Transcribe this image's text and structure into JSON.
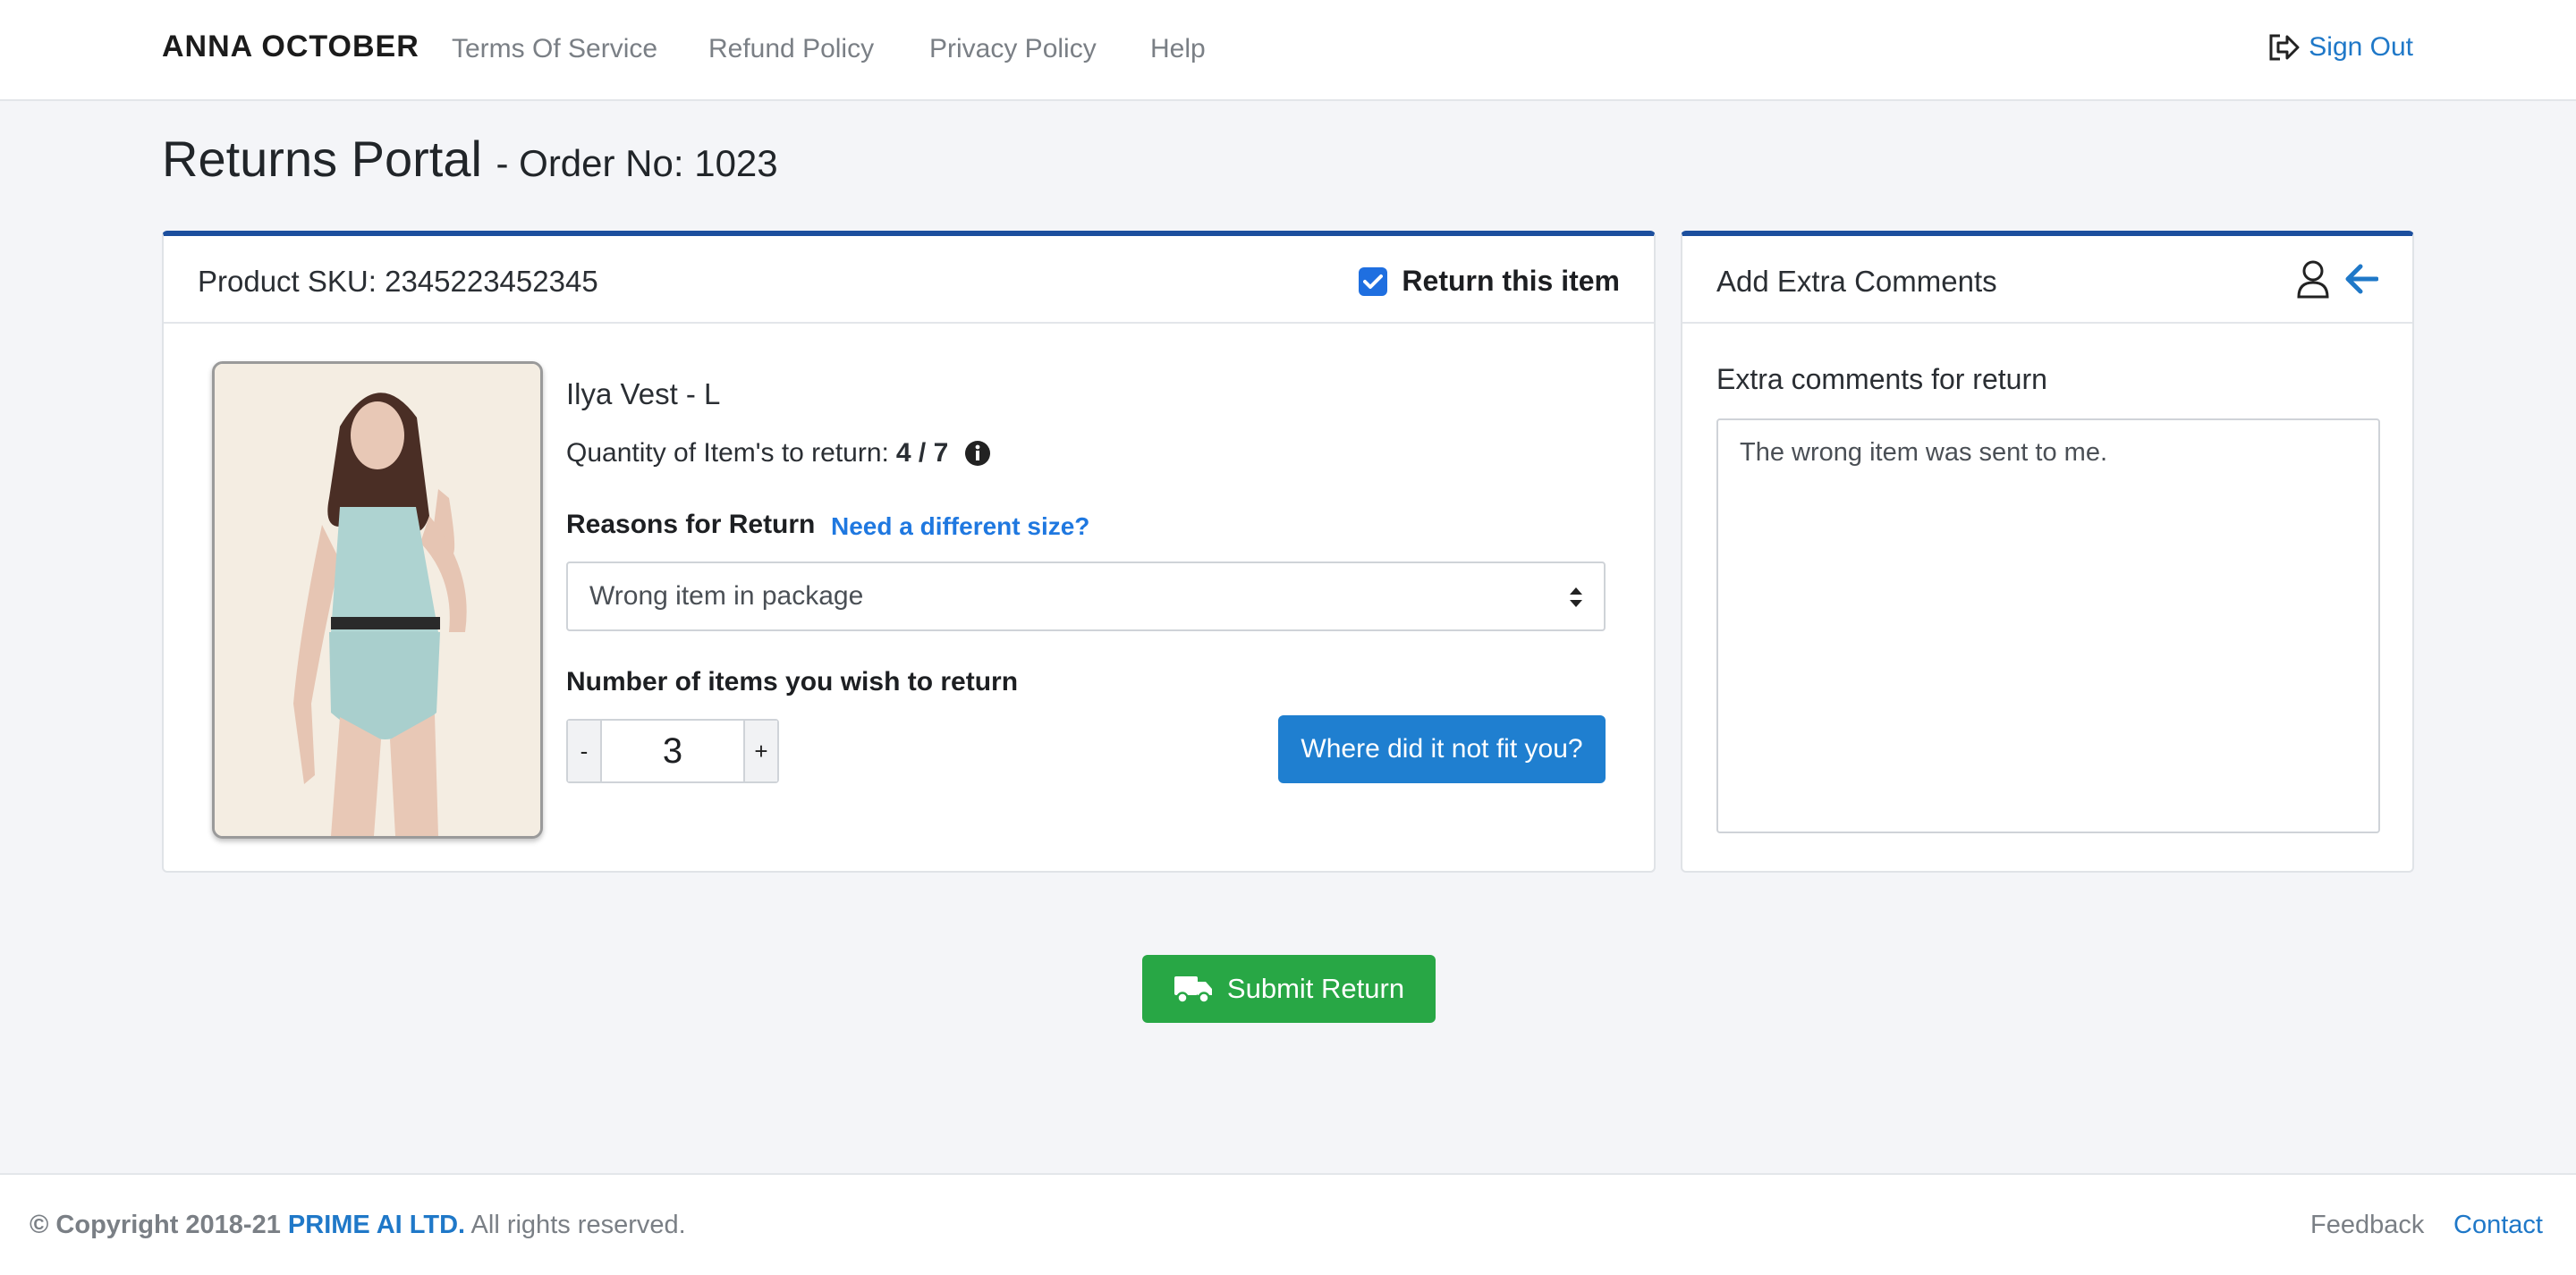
{
  "header": {
    "brand": "ANNA OCTOBER",
    "nav": [
      "Terms Of Service",
      "Refund Policy",
      "Privacy Policy",
      "Help"
    ],
    "sign_out": "Sign Out"
  },
  "title": {
    "main": "Returns Portal",
    "order": "- Order No: 1023"
  },
  "product": {
    "sku": "Product SKU: 2345223452345",
    "return_label": "Return this item",
    "return_checked": true,
    "name": "Ilya Vest - L",
    "qty_prefix": "Quantity of Item's to return:",
    "qty_value": "4 / 7",
    "reasons_label": "Reasons for Return",
    "different_size_link": "Need a different size?",
    "reason_selected": "Wrong item in package",
    "num_label": "Number of items you wish to return",
    "minus": "-",
    "stepper_value": "3",
    "plus": "+",
    "fit_button": "Where did it not fit you?"
  },
  "comments": {
    "title": "Add Extra Comments",
    "label": "Extra comments for return",
    "text": "The wrong item was sent to me."
  },
  "submit": "Submit Return",
  "footer": {
    "copy_prefix": "© Copyright 2018-21",
    "company": "PRIME AI LTD.",
    "rights": "All rights reserved.",
    "feedback": "Feedback",
    "contact": "Contact"
  },
  "colors": {
    "accent_blue": "#1f7fd0",
    "card_top_border": "#1c4f9e",
    "submit_green": "#28a745"
  }
}
